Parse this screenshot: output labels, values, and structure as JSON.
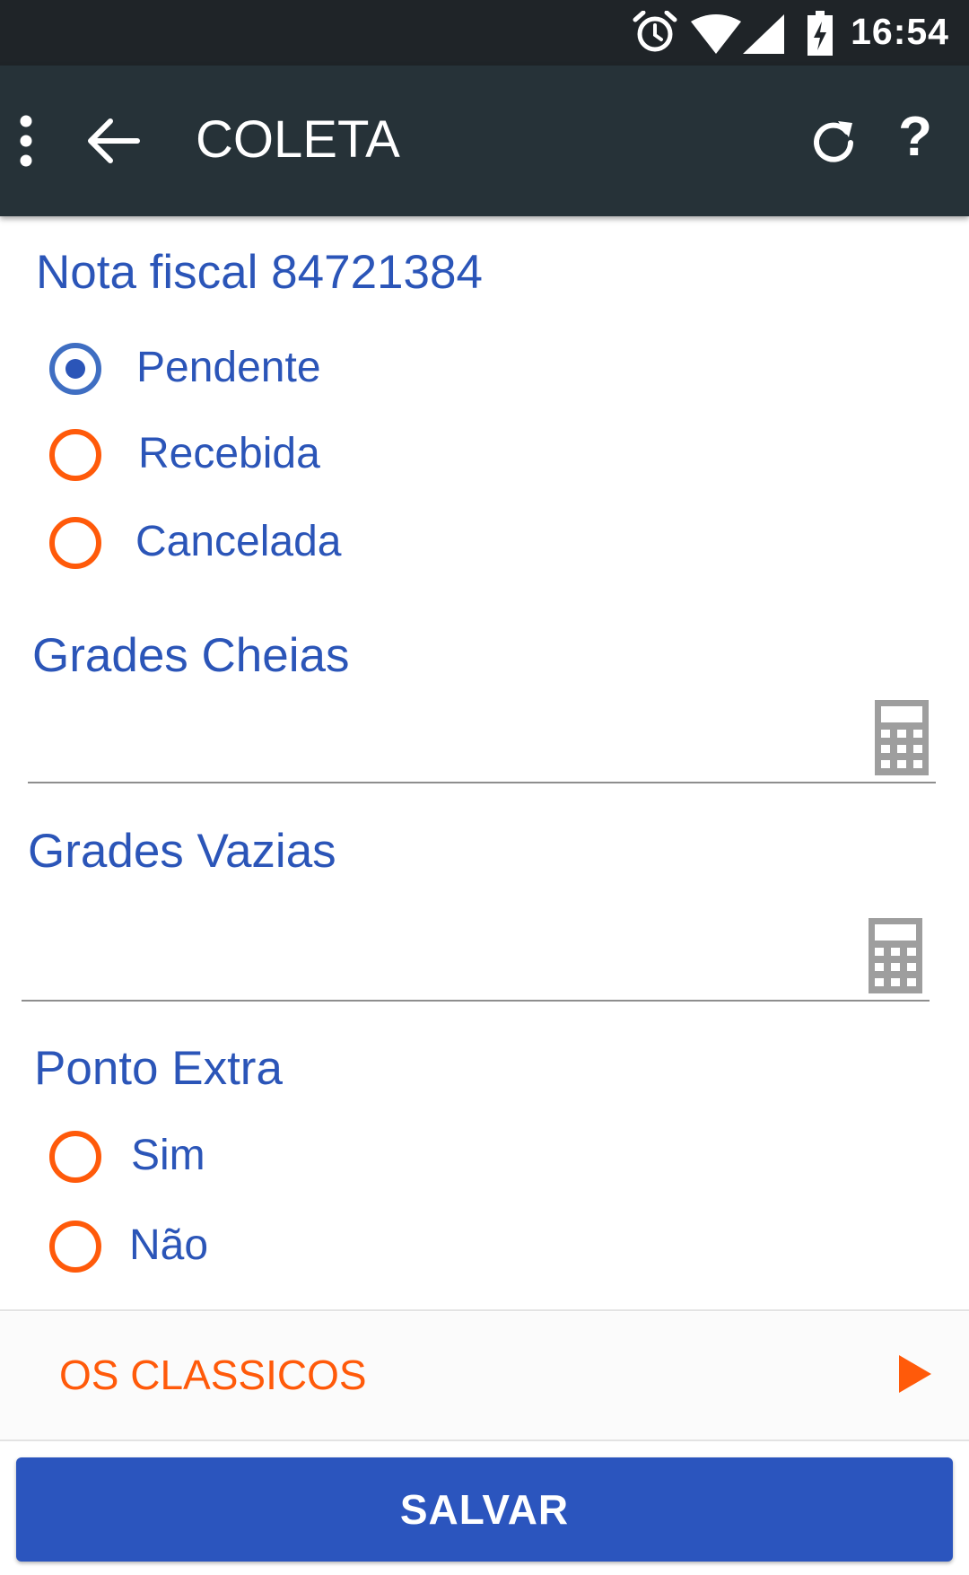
{
  "status_bar": {
    "time": "16:54",
    "icons": [
      "alarm-icon",
      "wifi-icon",
      "signal-icon",
      "battery-charging-icon"
    ]
  },
  "app_bar": {
    "title": "COLETA",
    "help_label": "?",
    "icons": [
      "overflow-menu-icon",
      "back-arrow-icon",
      "refresh-icon"
    ]
  },
  "nota_fiscal": {
    "title": "Nota fiscal 84721384",
    "options": [
      {
        "label": "Pendente",
        "checked": true
      },
      {
        "label": "Recebida",
        "checked": false
      },
      {
        "label": "Cancelada",
        "checked": false
      }
    ]
  },
  "grades_cheias": {
    "label": "Grades Cheias",
    "value": "",
    "icon": "calculator-icon"
  },
  "grades_vazias": {
    "label": "Grades Vazias",
    "value": "",
    "icon": "calculator-icon"
  },
  "ponto_extra": {
    "title": "Ponto Extra",
    "options": [
      {
        "label": "Sim",
        "checked": false
      },
      {
        "label": "Não",
        "checked": false
      }
    ]
  },
  "link_row": {
    "label": "OS CLASSICOS",
    "icon": "play-arrow-icon"
  },
  "save_button": {
    "label": "SALVAR"
  },
  "colors": {
    "primary_blue": "#2b55be",
    "accent_orange": "#ff5a0a",
    "app_bar": "#263238",
    "status_bar": "#1f2428"
  }
}
